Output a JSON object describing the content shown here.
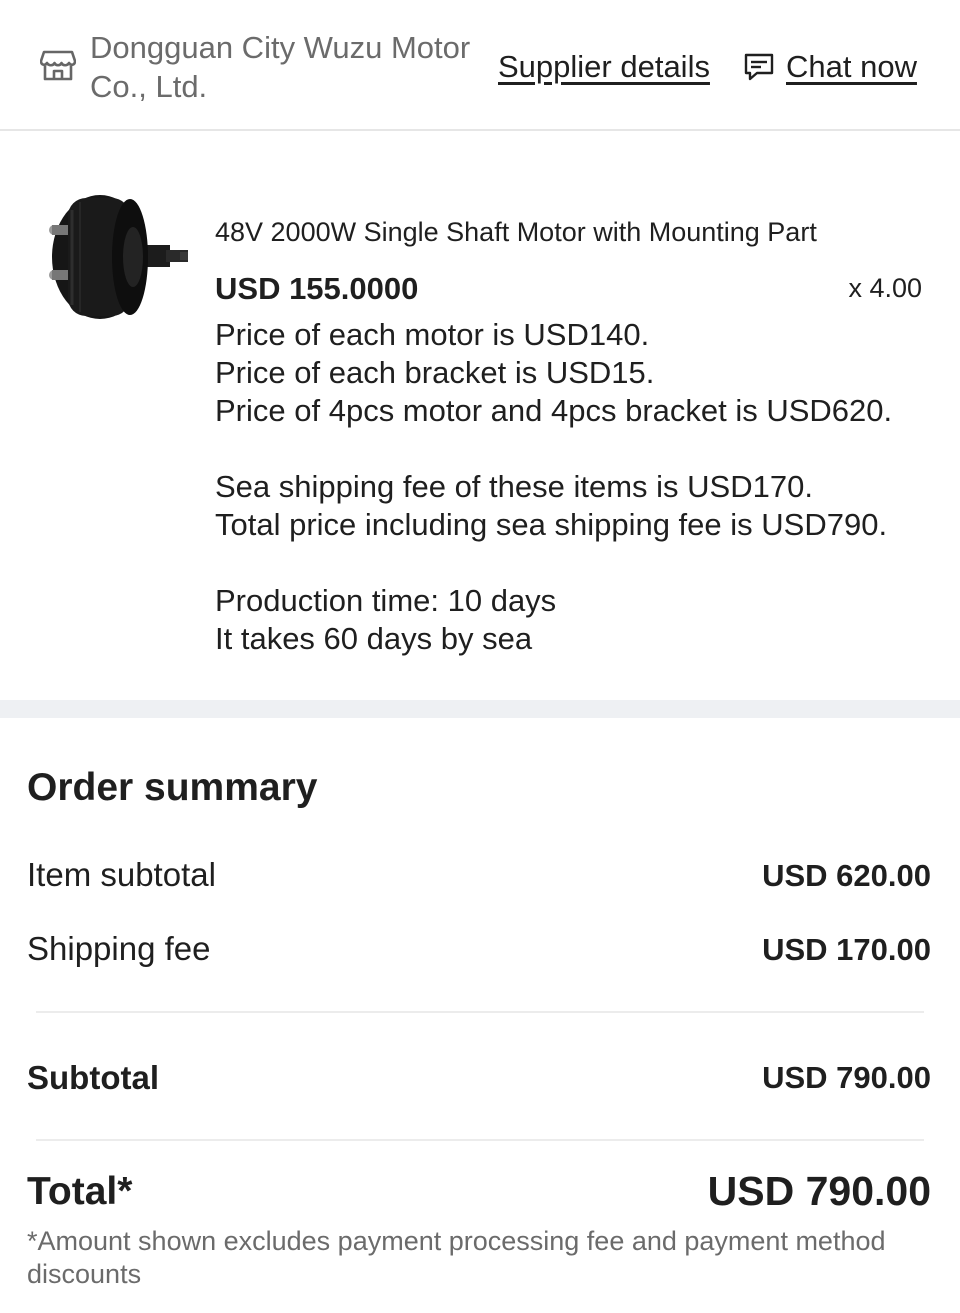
{
  "supplier": {
    "name": "Dongguan City Wuzu Motor Co., Ltd.",
    "details_link": "Supplier details",
    "chat_link": "Chat now",
    "store_icon": "store-icon",
    "chat_icon": "chat-bubble-icon"
  },
  "product": {
    "image_icon": "hub-motor-image",
    "title": "48V 2000W Single Shaft Motor with Mounting Part",
    "unit_price": "USD 155.0000",
    "quantity": "x 4.00",
    "note_lines": [
      "Price of each motor is USD140.",
      "Price of each bracket is USD15.",
      "Price of 4pcs motor and 4pcs bracket is USD620.",
      "",
      "Sea shipping fee of these items is USD170.",
      "Total price including sea shipping fee is USD790.",
      "",
      "Production time: 10 days",
      "It takes 60 days by sea"
    ]
  },
  "order_summary": {
    "title": "Order summary",
    "item_subtotal_label": "Item subtotal",
    "item_subtotal_value": "USD 620.00",
    "shipping_fee_label": "Shipping fee",
    "shipping_fee_value": "USD 170.00",
    "subtotal_label": "Subtotal",
    "subtotal_value": "USD 790.00",
    "total_label": "Total*",
    "total_value": "USD 790.00",
    "disclaimer": "*Amount shown excludes payment processing fee and payment method discounts"
  }
}
